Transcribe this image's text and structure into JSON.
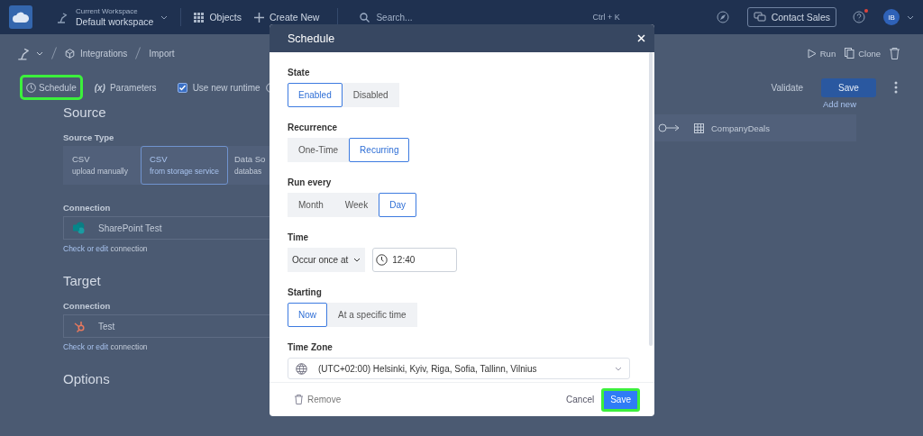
{
  "topbar": {
    "workspace_label": "Current Workspace",
    "workspace_name": "Default workspace",
    "nav": [
      "Objects",
      "Create New"
    ],
    "search_placeholder": "Search...",
    "shortcut": "Ctrl + K",
    "contact": "Contact Sales",
    "notification": true,
    "avatar": "IB"
  },
  "breadcrumb": [
    "Integrations",
    "Import"
  ],
  "toolbar": {
    "tabs": [
      {
        "kind": "schedule",
        "label": "Schedule",
        "highlighted": true
      },
      {
        "kind": "parameters",
        "icon": "(x)",
        "label": "Parameters",
        "highlighted": false
      }
    ],
    "runtime": {
      "label": "Use new runtime",
      "checked": true
    },
    "actions": [
      "Run",
      "Clone"
    ],
    "validate": "Validate",
    "save": "Save"
  },
  "source": {
    "title": "Source",
    "type_label": "Source Type",
    "types": [
      {
        "title": "CSV",
        "subtitle": "upload manually",
        "selected": false
      },
      {
        "title": "CSV",
        "subtitle": "from storage service",
        "selected": true
      },
      {
        "title": "Data So",
        "subtitle": "databas",
        "selected": false
      }
    ],
    "connection_label": "Connection",
    "connection": "SharePoint Test",
    "link": "Check or edit",
    "link_rest": "connection"
  },
  "target": {
    "title": "Target",
    "connection_label": "Connection",
    "connection": "Test",
    "link": "Check or edit",
    "link_rest": "connection"
  },
  "options": {
    "title": "Options"
  },
  "mapping": {
    "add": "Add new",
    "object": "CompanyDeals"
  },
  "dialog": {
    "title": "Schedule",
    "sections": [
      {
        "kind": "segments",
        "label": "State",
        "options": [
          {
            "label": "Enabled",
            "selected": true
          },
          {
            "label": "Disabled",
            "selected": false
          }
        ]
      },
      {
        "kind": "segments",
        "label": "Recurrence",
        "options": [
          {
            "label": "One-Time",
            "selected": false
          },
          {
            "label": "Recurring",
            "selected": true
          }
        ]
      },
      {
        "kind": "segments",
        "label": "Run every",
        "options": [
          {
            "label": "Month",
            "selected": false
          },
          {
            "label": "Week",
            "selected": false
          },
          {
            "label": "Day",
            "selected": true
          }
        ]
      },
      {
        "kind": "time",
        "label": "Time",
        "mode": "Occur once at",
        "value": "12:40"
      },
      {
        "kind": "segments",
        "label": "Starting",
        "options": [
          {
            "label": "Now",
            "selected": true
          },
          {
            "label": "At a specific time",
            "selected": false
          }
        ]
      },
      {
        "kind": "timezone",
        "label": "Time Zone",
        "value": "(UTC+02:00) Helsinki, Kyiv, Riga, Sofia, Tallinn, Vilnius"
      }
    ],
    "remove": "Remove",
    "cancel": "Cancel",
    "save": {
      "label": "Save",
      "highlighted": true
    }
  }
}
